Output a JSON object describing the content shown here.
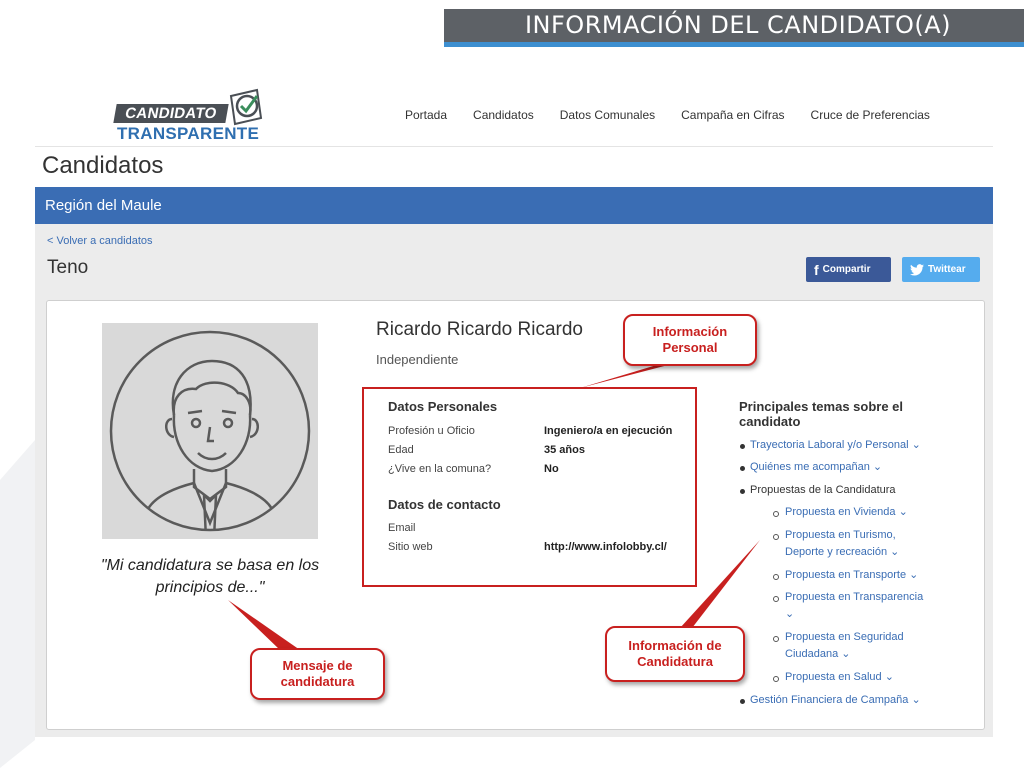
{
  "slide": {
    "title": "INFORMACIÓN DEL CANDIDATO(A)"
  },
  "site": {
    "logo_top": "CANDIDATO",
    "logo_bottom": "TRANSPARENTE",
    "nav": [
      "Portada",
      "Candidatos",
      "Datos Comunales",
      "Campaña en Cifras",
      "Cruce de Preferencias"
    ],
    "page_heading": "Candidatos",
    "region": "Región del Maule",
    "back_link": "< Volver a candidatos",
    "commune": "Teno",
    "share_facebook": "Compartir",
    "share_twitter": "Twittear"
  },
  "candidate": {
    "name": "Ricardo Ricardo Ricardo",
    "party": "Independiente",
    "quote": "\"Mi candidatura se basa en los principios de...\"",
    "personal_title": "Datos Personales",
    "personal_rows": [
      {
        "label": "Profesión u Oficio",
        "value": "Ingeniero/a en ejecución"
      },
      {
        "label": "Edad",
        "value": "35 años"
      },
      {
        "label": "¿Vive en la comuna?",
        "value": "No"
      }
    ],
    "contact_title": "Datos de contacto",
    "contact_rows": [
      {
        "label": "Email",
        "value": ""
      },
      {
        "label": "Sitio web",
        "value": "http://www.infolobby.cl/"
      }
    ],
    "topics_title": "Principales temas sobre el candidato",
    "topics": [
      {
        "label": "Trayectoria Laboral y/o Personal",
        "link": true
      },
      {
        "label": "Quiénes me acompañan",
        "link": true
      },
      {
        "label": "Propuestas de la Candidatura",
        "link": false
      },
      {
        "label": "Propuesta en Vivienda",
        "link": true
      },
      {
        "label": "Propuesta en Turismo, Deporte y recreación",
        "link": true
      },
      {
        "label": "Propuesta en Transporte",
        "link": true
      },
      {
        "label": "Propuesta en Transparencia",
        "link": true
      },
      {
        "label": "Propuesta en Seguridad Ciudadana",
        "link": true
      },
      {
        "label": "Propuesta en Salud",
        "link": true
      },
      {
        "label": "Gestión Financiera de Campaña",
        "link": true
      }
    ]
  },
  "annotations": {
    "personal": "Información Personal",
    "candidacy": "Información de Candidatura",
    "message": "Mensaje de candidatura"
  },
  "colors": {
    "accent_blue": "#3a6db4",
    "annotation_red": "#c8201f",
    "facebook": "#3b5998",
    "twitter": "#55acee"
  }
}
